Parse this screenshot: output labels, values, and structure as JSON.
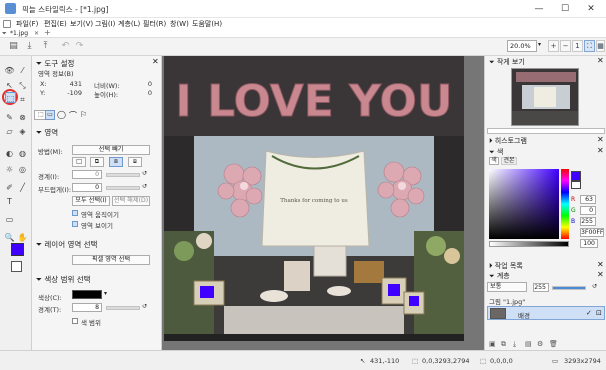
{
  "window": {
    "title": "픽늘 스타일릭스 - [*1.jpg]",
    "controls": {
      "minimize": "—",
      "maximize": "☐",
      "close": "✕"
    }
  },
  "menu": [
    {
      "label": "파일(F)"
    },
    {
      "label": "편집(E)"
    },
    {
      "label": "보기(V)"
    },
    {
      "label": "그림(I)"
    },
    {
      "label": "계층(L)"
    },
    {
      "label": "필터(R)"
    },
    {
      "label": "창(W)"
    },
    {
      "label": "도움말(H)"
    }
  ],
  "tab": {
    "label": "*1.jpg",
    "close": "✕",
    "add": "+"
  },
  "toolbar": {
    "zoom": "20.0%"
  },
  "tool_settings": {
    "title": "도구 설정",
    "area_info": "영역 정보(B)",
    "x_label": "X:",
    "x_value": "431",
    "y_label": "Y:",
    "y_value": "-109",
    "width_label": "너비(W):",
    "width_value": "0",
    "height_label": "높이(H):",
    "height_value": "0"
  },
  "region": {
    "title": "영역",
    "method_label": "방법(M):",
    "method_value": "선택 빼기",
    "border_label": "경계(I):",
    "border_value": "0",
    "feather_label": "부드럽게(I):",
    "feather_value": "0",
    "select_all": "모두 선택(I)",
    "deselect": "선택 해제(D)",
    "move_region": "영역 움직이기",
    "show_region": "영역 보이기"
  },
  "layer_select": {
    "title": "레이어 영역 선택",
    "button": "픽셀 영역 선택"
  },
  "color_range": {
    "title": "색상 범위 선택",
    "color_label": "색상(C):",
    "border_label": "경계(T):",
    "border_value": "8",
    "color_range_check": "색 범위"
  },
  "right_panel": {
    "preview_title": "작게 보기",
    "histogram_title": "히스토그램",
    "color_title": "색",
    "color_tabs": [
      "색",
      "견본"
    ],
    "color_values": [
      "63",
      "0",
      "255",
      "3F00FF",
      "100"
    ],
    "history_title": "작업 목록",
    "layers_title": "계층",
    "blend_mode": "보통",
    "opacity": "255",
    "image_label": "그림 \"1.jpg\"",
    "layer_name": "배경"
  },
  "photo": {
    "banner_text": "I LOVE YOU",
    "banner_cloth_text": "Thanks for coming to us"
  },
  "status": {
    "cursor": "431,-110",
    "selection": "0,0,3293,2794",
    "sel_size": "0,0,0,0",
    "image_size": "3293x2794"
  },
  "colors": {
    "primary": "#3f00ff",
    "secondary": "#ffffff",
    "highlight_circle": "#e53030"
  }
}
